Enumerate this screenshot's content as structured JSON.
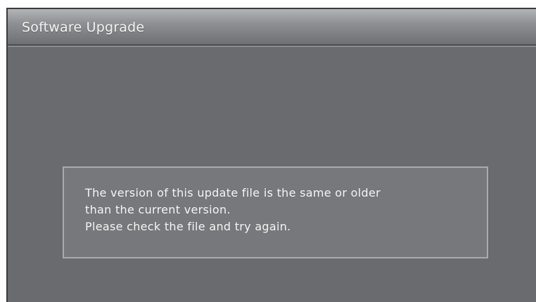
{
  "window": {
    "title": "Software Upgrade"
  },
  "dialog": {
    "lines": [
      "The version of this update file is the same or older",
      "than the current version.",
      "Please check the file and try again."
    ]
  },
  "colors": {
    "background": "#6a6b6f",
    "title_bar": "#9a9b9e",
    "message_box": "#77787c",
    "message_border": "#a9aaad",
    "text": "#f4f4f4"
  }
}
